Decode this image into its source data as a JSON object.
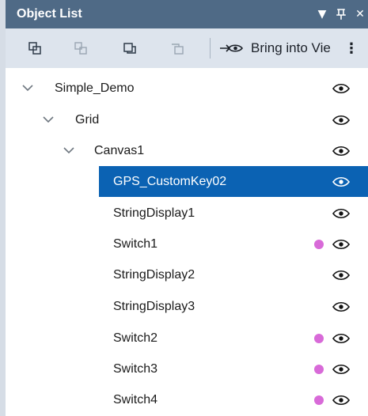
{
  "panel": {
    "title": "Object List",
    "controls": {
      "menu_glyph": "▼",
      "pin_glyph": "ⅱ",
      "close_glyph": "✕"
    }
  },
  "toolbar": {
    "bring_into_view_label": "Bring into Vie",
    "more_glyph": "⋮"
  },
  "tree": {
    "items": [
      {
        "label": "Simple_Demo",
        "expanded": true,
        "has_dot": false,
        "selected": false,
        "level": 0
      },
      {
        "label": "Grid",
        "expanded": true,
        "has_dot": false,
        "selected": false,
        "level": 1
      },
      {
        "label": "Canvas1",
        "expanded": true,
        "has_dot": false,
        "selected": false,
        "level": 2
      },
      {
        "label": "GPS_CustomKey02",
        "expanded": false,
        "has_dot": false,
        "selected": true,
        "level": 3
      },
      {
        "label": "StringDisplay1",
        "expanded": false,
        "has_dot": false,
        "selected": false,
        "level": 3
      },
      {
        "label": "Switch1",
        "expanded": false,
        "has_dot": true,
        "selected": false,
        "level": 3
      },
      {
        "label": "StringDisplay2",
        "expanded": false,
        "has_dot": false,
        "selected": false,
        "level": 3
      },
      {
        "label": "StringDisplay3",
        "expanded": false,
        "has_dot": false,
        "selected": false,
        "level": 3
      },
      {
        "label": "Switch2",
        "expanded": false,
        "has_dot": true,
        "selected": false,
        "level": 3
      },
      {
        "label": "Switch3",
        "expanded": false,
        "has_dot": true,
        "selected": false,
        "level": 3
      },
      {
        "label": "Switch4",
        "expanded": false,
        "has_dot": true,
        "selected": false,
        "level": 3
      }
    ]
  },
  "colors": {
    "title_bar": "#4f6a86",
    "toolbar": "#dde4ed",
    "selected_row": "#0b62b3",
    "dot": "#d86ad8",
    "icon": "#111111"
  }
}
